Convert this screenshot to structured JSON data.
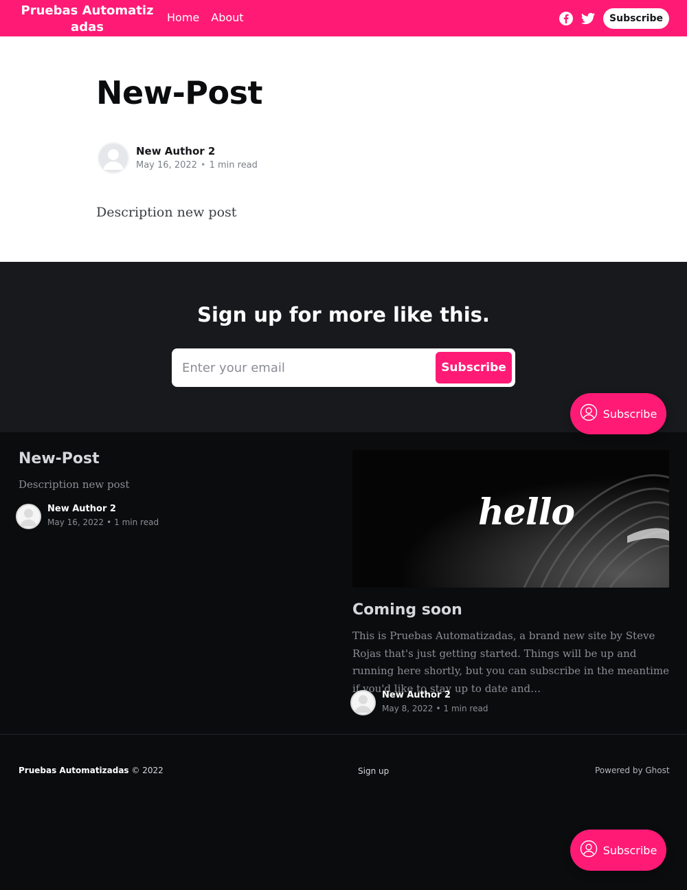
{
  "header": {
    "site_title": "Pruebas Automatizadas",
    "nav": [
      "Home",
      "About"
    ],
    "icons": [
      "facebook-icon",
      "twitter-icon"
    ],
    "subscribe_label": "Subscribe"
  },
  "article": {
    "title": "New-Post",
    "author": "New Author 2",
    "date": "May 16, 2022",
    "read_time": "1 min read",
    "body": "Description new post"
  },
  "cta": {
    "title": "Sign up for more like this.",
    "input_placeholder": "Enter your email",
    "button_label": "Subscribe"
  },
  "floating_subscribe": {
    "label": "Subscribe",
    "icon": "user-circle-icon"
  },
  "related": [
    {
      "title": "New-Post",
      "excerpt": "Description new post",
      "author": "New Author 2",
      "date": "May 16, 2022",
      "read_time": "1 min read"
    },
    {
      "title": "Coming soon",
      "image_text": "hello",
      "excerpt": "This is Pruebas Automatizadas, a brand new site by Steve Rojas that's just getting started. Things will be up and running here shortly, but you can subscribe in the meantime if you'd like to stay up to date and…",
      "author": "New Author 2",
      "date": "May 8, 2022",
      "read_time": "1 min read"
    }
  ],
  "footer": {
    "site_name": "Pruebas Automatizadas",
    "copyright": "© 2022",
    "signup": "Sign up",
    "powered": "Powered by Ghost"
  },
  "colors": {
    "accent": "#ff1a75",
    "dark": "#18191d",
    "darker": "#0b0c0e"
  }
}
